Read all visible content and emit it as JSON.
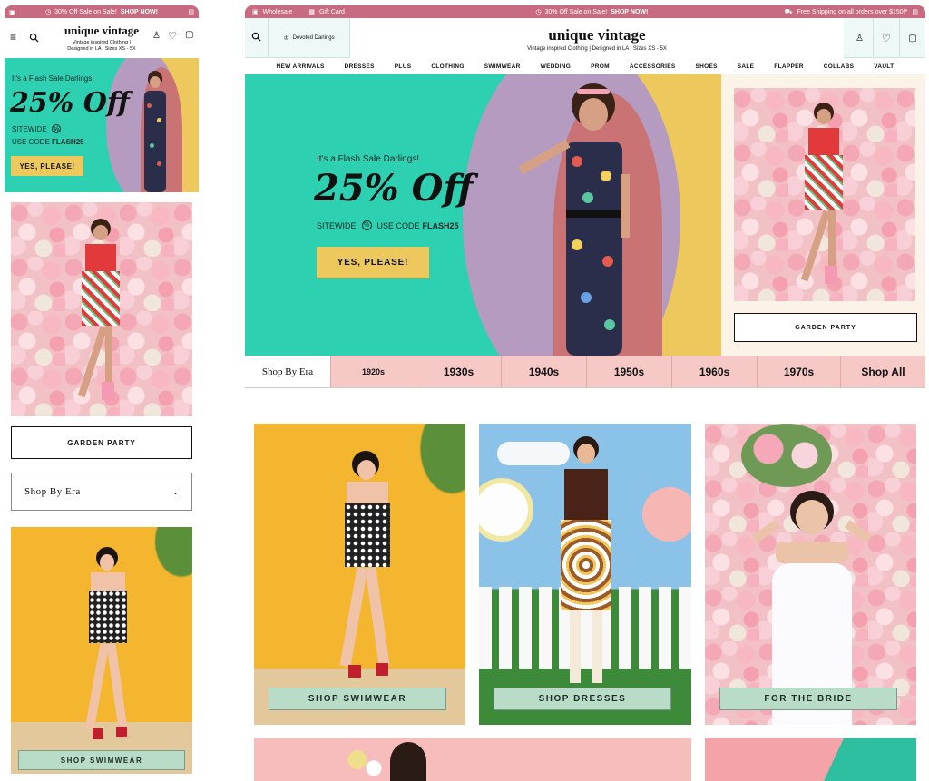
{
  "mobile": {
    "promo": {
      "text": "30% Off Sale on Sale!",
      "bold": "SHOP NOW!"
    },
    "brand": {
      "name": "unique vintage",
      "tag1": "Vintage inspired Clothing |",
      "tag2": "Designed in LA | Sizes XS - 5X"
    },
    "hero": {
      "kicker": "It's a Flash Sale Darlings!",
      "big": "25% Off",
      "sitewide": "SITEWIDE",
      "code_prefix": "USE CODE",
      "code": "FLASH25",
      "cta": "YES, PLEASE!"
    },
    "garden_button": "GARDEN PARTY",
    "era_dropdown": "Shop By Era",
    "swim_label": "SHOP SWIMWEAR"
  },
  "desktop": {
    "promo": {
      "left1": "Wholesale",
      "left2": "Gift Card",
      "center": "30% Off Sale on Sale!",
      "center_bold": "SHOP NOW!",
      "right": "Free Shipping on all orders over $150!*"
    },
    "header": {
      "account_label": "Devoted Darlings",
      "brand": "unique vintage",
      "tagline": "Vintage inspired Clothing | Designed in LA | Sizes XS - 5X"
    },
    "nav": [
      "NEW ARRIVALS",
      "DRESSES",
      "PLUS",
      "CLOTHING",
      "SWIMWEAR",
      "WEDDING",
      "PROM",
      "ACCESSORIES",
      "SHOES",
      "SALE",
      "FLAPPER",
      "COLLABS",
      "VAULT"
    ],
    "hero": {
      "kicker": "It's a Flash Sale Darlings!",
      "big": "25% Off",
      "sitewide": "SITEWIDE",
      "code_prefix": "USE CODE",
      "code": "FLASH25",
      "cta": "YES, PLEASE!"
    },
    "garden_button": "GARDEN PARTY",
    "era_label": "Shop By Era",
    "eras": [
      "1920s",
      "1930s",
      "1940s",
      "1950s",
      "1960s",
      "1970s",
      "Shop All"
    ],
    "categories": [
      "SHOP SWIMWEAR",
      "SHOP DRESSES",
      "FOR THE BRIDE"
    ]
  },
  "colors": {
    "promo": "#c86a80",
    "teal": "#2dd0b1",
    "gold": "#edc85c",
    "pink_era": "#f6c9c6",
    "mint_label": "#b9dcc8"
  }
}
